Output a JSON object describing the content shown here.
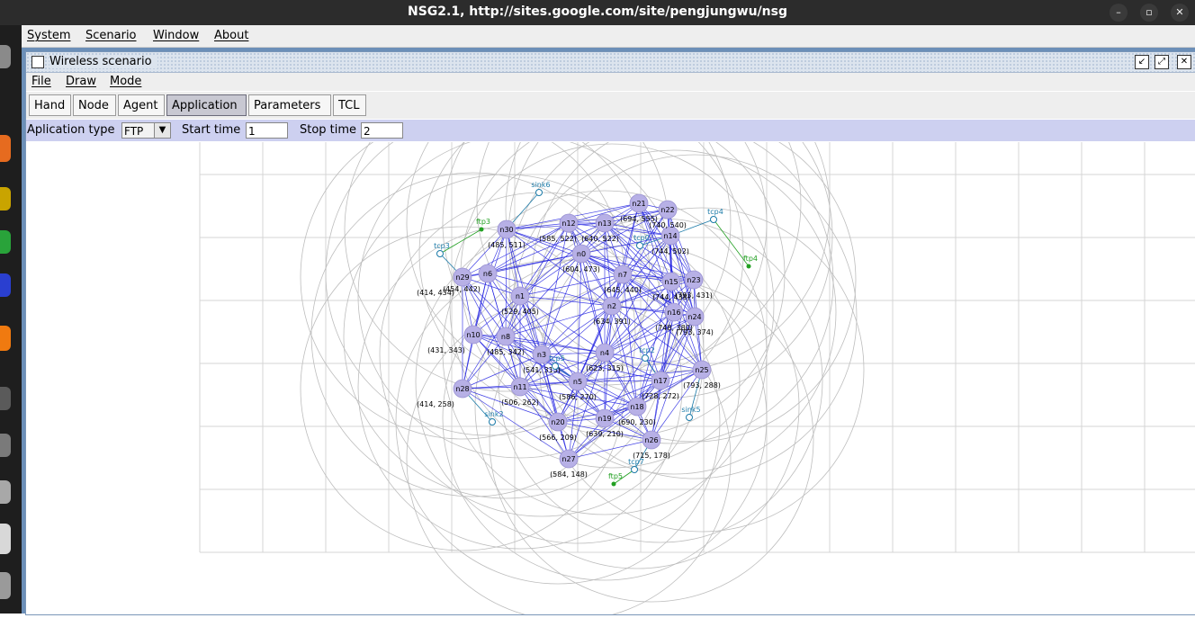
{
  "window": {
    "title": "NSG2.1, http://sites.google.com/site/pengjungwu/nsg",
    "minimize_glyph": "–",
    "maximize_glyph": "▫",
    "close_glyph": "✕"
  },
  "menubar": [
    "System",
    "Scenario",
    "Window",
    "About"
  ],
  "internal_frame": {
    "title": "Wireless scenario",
    "menu": [
      "File",
      "Draw",
      "Mode"
    ],
    "toolbar": [
      {
        "label": "Hand",
        "active": false
      },
      {
        "label": "Node",
        "active": false
      },
      {
        "label": "Agent",
        "active": false
      },
      {
        "label": "Application",
        "active": true
      },
      {
        "label": "Parameters",
        "active": false
      },
      {
        "label": "TCL",
        "active": false
      }
    ],
    "application_bar": {
      "type_label": "Aplication type",
      "type_value": "FTP",
      "start_label": "Start time",
      "start_value": "1",
      "stop_label": "Stop time",
      "stop_value": "2"
    }
  },
  "colors": {
    "node_fill": "#b7b0e6",
    "link": "#2020e0",
    "range_circle": "#bdbdbd",
    "grid": "#d4d4d4",
    "agent": "#1a7aa8",
    "app": "#22a022"
  },
  "nodes": [
    {
      "name": "n0",
      "coords": "(604, 473)"
    },
    {
      "name": "n1",
      "coords": "(529, 405)"
    },
    {
      "name": "n2",
      "coords": "(634, 391)"
    },
    {
      "name": "n3",
      "coords": "(541, 313)"
    },
    {
      "name": "n4",
      "coords": "(623, 315)"
    },
    {
      "name": "n5",
      "coords": "(586, 270)"
    },
    {
      "name": "n6",
      "coords": "(454, 442)"
    },
    {
      "name": "n7",
      "coords": "(645, 440)"
    },
    {
      "name": "n8",
      "coords": "(485, 342)"
    },
    {
      "name": "n10",
      "coords": "(431, 343)"
    },
    {
      "name": "n11",
      "coords": "(506, 262)"
    },
    {
      "name": "n12",
      "coords": "(585, 522)"
    },
    {
      "name": "n13",
      "coords": "(640, 522)"
    },
    {
      "name": "n14",
      "coords": "(744, 502)"
    },
    {
      "name": "n15",
      "coords": "(744, 438)"
    },
    {
      "name": "n16",
      "coords": "(748, 380)"
    },
    {
      "name": "n17",
      "coords": "(728, 272)"
    },
    {
      "name": "n18",
      "coords": "(690, 230)"
    },
    {
      "name": "n19",
      "coords": "(639, 210)"
    },
    {
      "name": "n20",
      "coords": "(566, 209)"
    },
    {
      "name": "n21",
      "coords": "(694, 555)"
    },
    {
      "name": "n22",
      "coords": "(740, 540)"
    },
    {
      "name": "n23",
      "coords": "(793, 431)"
    },
    {
      "name": "n24",
      "coords": "(793, 374)"
    },
    {
      "name": "n25",
      "coords": "(793, 288)"
    },
    {
      "name": "n26",
      "coords": "(715, 178)"
    },
    {
      "name": "n27",
      "coords": "(584, 148)"
    },
    {
      "name": "n28",
      "coords": "(414, 258)"
    },
    {
      "name": "n29",
      "coords": "(414, 434)"
    },
    {
      "name": "n30",
      "coords": "(485, 511)"
    }
  ],
  "agents": {
    "tcp": [
      "tcp0",
      "tcp2",
      "tcp3",
      "tcp4",
      "tcp5",
      "tcp7"
    ],
    "sink": [
      "sink2",
      "sink5",
      "sink6"
    ],
    "ftp": [
      "ftp3",
      "ftp4",
      "ftp5"
    ]
  }
}
